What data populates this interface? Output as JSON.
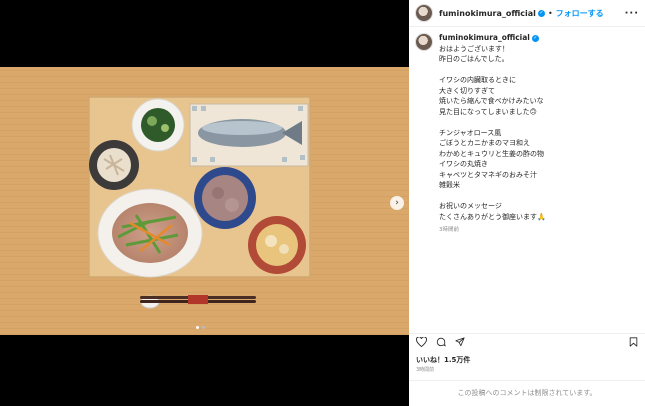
{
  "post": {
    "username": "fuminokimura_official",
    "separator": "•",
    "follow_label": "フォローする",
    "more_label": "···",
    "caption_lines": [
      "おはようございます！",
      "昨日のごはんでした。",
      "",
      "イワシの内臓取るときに",
      "大きく切りすぎて",
      "焼いたら縮んで食べかけみたいな",
      "見た目になってしまいました🙃",
      "",
      "チンジャオロース風",
      "ごぼうとカニかまのマヨ和え",
      "わかめとキュウリと生姜の酢の物",
      "イワシの丸焼き",
      "キャベツとタマネギのおみそ汁",
      "雑穀米",
      "",
      "お祝いのメッセージ",
      "たくさんありがとう御座います🙏"
    ],
    "time_ago": "3時間前",
    "likes": "いいね！1.5万件",
    "date": "3時間前",
    "comments_closed": "この投稿へのコメントは制限されています。"
  },
  "media": {
    "next_arrow": "›",
    "slide_count": 2,
    "active_slide": 1
  }
}
